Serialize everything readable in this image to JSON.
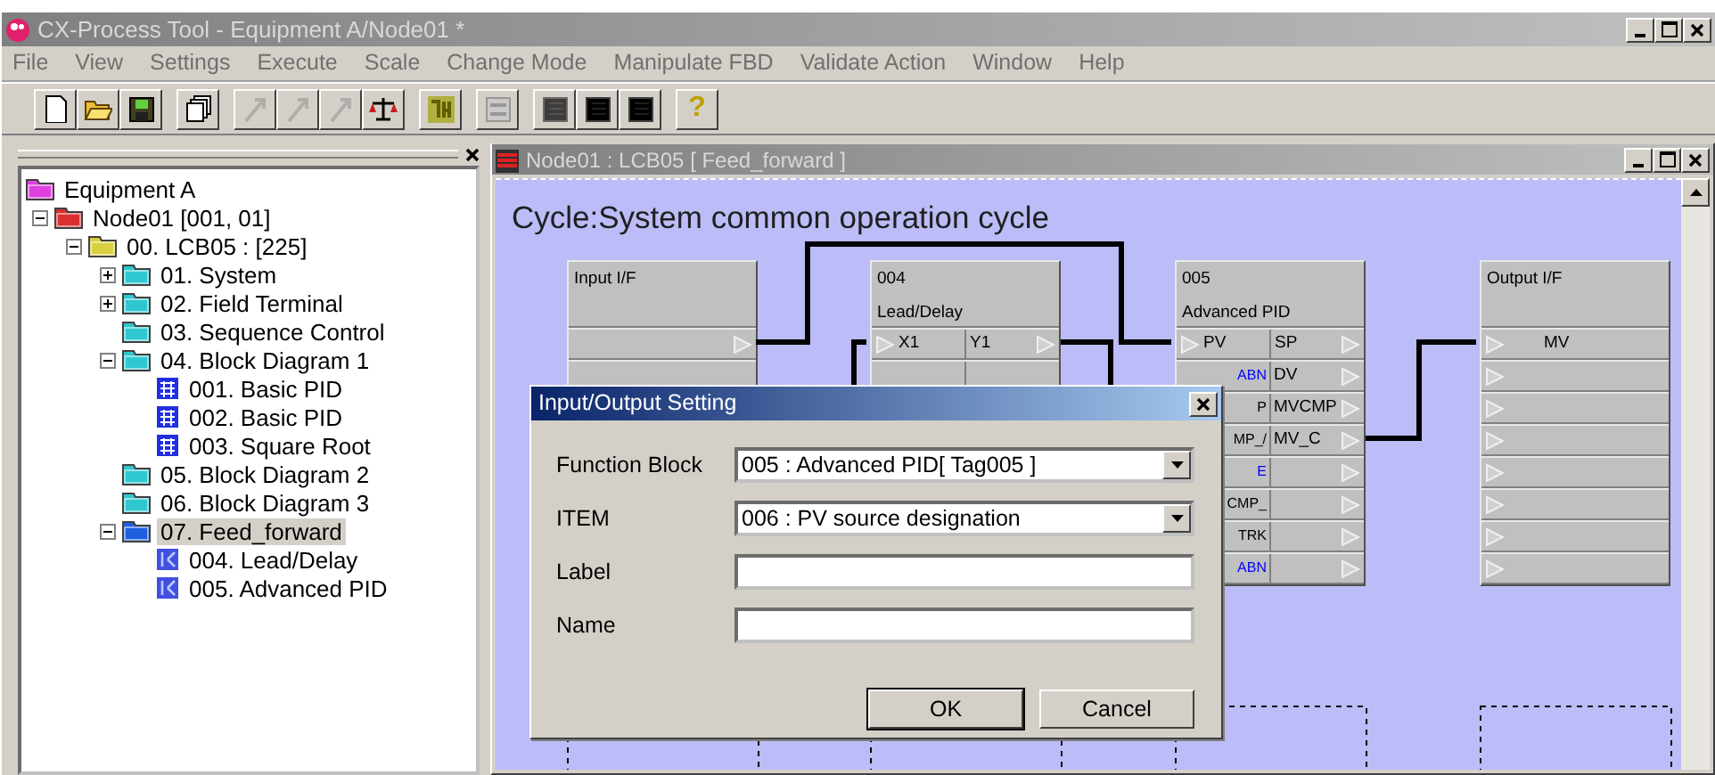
{
  "window": {
    "title": "CX-Process Tool - Equipment A/Node01 *"
  },
  "menu": [
    "File",
    "View",
    "Settings",
    "Execute",
    "Scale",
    "Change Mode",
    "Manipulate FBD",
    "Validate Action",
    "Window",
    "Help"
  ],
  "toolbar": [
    [
      {
        "kind": "new",
        "disabled": false
      },
      {
        "kind": "open",
        "disabled": false
      },
      {
        "kind": "save",
        "disabled": false
      }
    ],
    [
      {
        "kind": "copy",
        "disabled": false
      }
    ],
    [
      {
        "kind": "arrow",
        "disabled": true
      },
      {
        "kind": "arrow",
        "disabled": true
      },
      {
        "kind": "arrow",
        "disabled": true
      },
      {
        "kind": "balance",
        "disabled": false
      }
    ],
    [
      {
        "kind": "run",
        "disabled": false
      }
    ],
    [
      {
        "kind": "stop",
        "disabled": true
      }
    ],
    [
      {
        "kind": "sheet",
        "disabled": true
      },
      {
        "kind": "sheet",
        "disabled": false
      },
      {
        "kind": "sheet",
        "disabled": false
      }
    ],
    [
      {
        "kind": "help",
        "disabled": false,
        "glyph": "?"
      }
    ]
  ],
  "tree": [
    {
      "label": "Equipment A",
      "kind": "folder",
      "color": "#e040e0",
      "selected": false,
      "children": [
        {
          "label": "Node01 [001, 01]",
          "kind": "folder",
          "color": "#d83030",
          "expanded": true,
          "selected": false,
          "children": [
            {
              "label": "00. LCB05 : [225]",
              "kind": "folder",
              "color": "#d8d040",
              "expanded": true,
              "selected": false,
              "children": [
                {
                  "label": "01. System",
                  "kind": "folder",
                  "color": "#30c8d0",
                  "expanded": false,
                  "selected": false
                },
                {
                  "label": "02. Field Terminal",
                  "kind": "folder",
                  "color": "#30c8d0",
                  "expanded": false,
                  "selected": false
                },
                {
                  "label": "03. Sequence Control",
                  "kind": "folder",
                  "color": "#30c8d0",
                  "selected": false
                },
                {
                  "label": "04. Block Diagram 1",
                  "kind": "folder",
                  "color": "#30c8d0",
                  "expanded": true,
                  "selected": false,
                  "children": [
                    {
                      "label": "001. Basic PID",
                      "kind": "sheet",
                      "selected": false
                    },
                    {
                      "label": "002. Basic PID",
                      "kind": "sheet",
                      "selected": false
                    },
                    {
                      "label": "003. Square Root",
                      "kind": "sheet",
                      "selected": false
                    }
                  ]
                },
                {
                  "label": "05. Block Diagram 2",
                  "kind": "folder",
                  "color": "#30c8d0",
                  "selected": false
                },
                {
                  "label": "06. Block Diagram 3",
                  "kind": "folder",
                  "color": "#30c8d0",
                  "selected": false
                },
                {
                  "label": "07. Feed_forward",
                  "kind": "folder",
                  "color": "#2060e0",
                  "expanded": true,
                  "selected": true,
                  "children": [
                    {
                      "label": "004. Lead/Delay",
                      "kind": "diagram",
                      "selected": false
                    },
                    {
                      "label": "005. Advanced PID",
                      "kind": "diagram",
                      "selected": false
                    }
                  ]
                }
              ]
            }
          ]
        }
      ]
    }
  ],
  "child_window": {
    "title": "Node01 : LCB05  [ Feed_forward ]",
    "cycle": "Cycle:System common operation cycle"
  },
  "blocks": [
    {
      "kind": "io",
      "lines": [
        "Input I/F"
      ],
      "rows": [
        {
          "in": false,
          "out": true
        },
        {
          "in": false,
          "out": false
        }
      ]
    },
    {
      "kind": "function",
      "lines": [
        "004",
        "Lead/Delay"
      ],
      "rows": [
        {
          "left": "X1",
          "right": "Y1",
          "in": true,
          "out": true
        },
        {
          "in": false,
          "out": false
        }
      ]
    },
    {
      "kind": "function",
      "lines": [
        "005",
        "Advanced PID"
      ],
      "rows": [
        {
          "left": "PV",
          "right": "SP",
          "in": true,
          "out": true
        },
        {
          "left": "ABN",
          "cut": true,
          "color": "#0000ff",
          "right": "DV",
          "in": false,
          "out": true
        },
        {
          "left": "P",
          "cut": true,
          "right": "MVCMP",
          "in": false,
          "out": true
        },
        {
          "left": "MP_/",
          "cut": true,
          "right": "MV_C",
          "in": false,
          "out": true
        },
        {
          "left": "E",
          "cut": true,
          "color": "#0000ff",
          "in": false,
          "out": true
        },
        {
          "left": "CMP_",
          "cut": true,
          "in": false,
          "out": true
        },
        {
          "left": "TRK",
          "cut": true,
          "in": false,
          "out": true
        },
        {
          "left": "ABN",
          "cut": true,
          "color": "#0000ff",
          "in": false,
          "out": true
        }
      ]
    },
    {
      "kind": "io",
      "lines": [
        "Output I/F"
      ],
      "rows": [
        {
          "left": "MV",
          "in": true,
          "out": false
        },
        {
          "in": true,
          "out": false
        },
        {
          "in": true,
          "out": false
        },
        {
          "in": true,
          "out": false
        },
        {
          "in": true,
          "out": false
        },
        {
          "in": true,
          "out": false
        },
        {
          "in": true,
          "out": false
        },
        {
          "in": true,
          "out": false
        }
      ]
    }
  ],
  "dialog": {
    "title": "Input/Output Setting",
    "fields": [
      {
        "label": "Function Block",
        "kind": "dropdown",
        "value": "005 : Advanced PID[ Tag005 ]"
      },
      {
        "label": "ITEM",
        "kind": "dropdown",
        "value": "006 : PV source designation"
      },
      {
        "label": "Label",
        "kind": "text"
      },
      {
        "label": "Name",
        "kind": "text"
      }
    ],
    "buttons": [
      {
        "label": "OK",
        "default": true
      },
      {
        "label": "Cancel",
        "default": false
      }
    ]
  }
}
